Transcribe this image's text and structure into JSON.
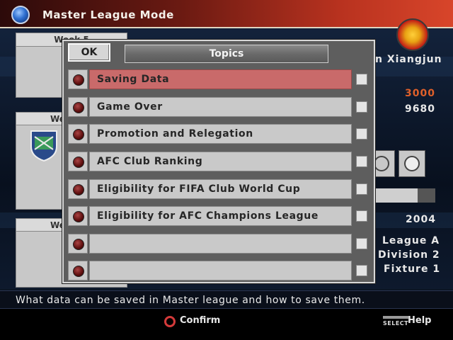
{
  "header": {
    "title": "Master League Mode"
  },
  "background": {
    "week_label_top": "Week 5",
    "week_label_mid": "We",
    "week_label_bot": "We",
    "manager_name": "n Xiangjun",
    "money_top": "3000",
    "money_bottom": "9680",
    "year": "2004",
    "league": "League A",
    "division": "Division 2",
    "fixture": "Fixture 1",
    "colors": {
      "money_top": "#e0602a",
      "text": "#e8e8e8"
    }
  },
  "dialog": {
    "ok_label": "OK",
    "header_title": "Topics",
    "items": [
      {
        "label": "Saving Data",
        "selected": true
      },
      {
        "label": "Game Over",
        "selected": false
      },
      {
        "label": "Promotion and Relegation",
        "selected": false
      },
      {
        "label": "AFC Club Ranking",
        "selected": false
      },
      {
        "label": "Eligibility for FIFA Club World Cup",
        "selected": false
      },
      {
        "label": "Eligibility for AFC Champions League",
        "selected": false
      },
      {
        "label": "",
        "selected": false
      },
      {
        "label": "",
        "selected": false
      }
    ],
    "colors": {
      "selected_row": "#c96a6a",
      "row": "#c9c9c9",
      "panel": "#5e5e5e"
    }
  },
  "help_text": "What data can be saved in Master league and how to save them.",
  "footer": {
    "confirm_label": "Confirm",
    "confirm_icon": "circle-button-icon",
    "select_label": "SELECT",
    "help_label": "Help"
  }
}
